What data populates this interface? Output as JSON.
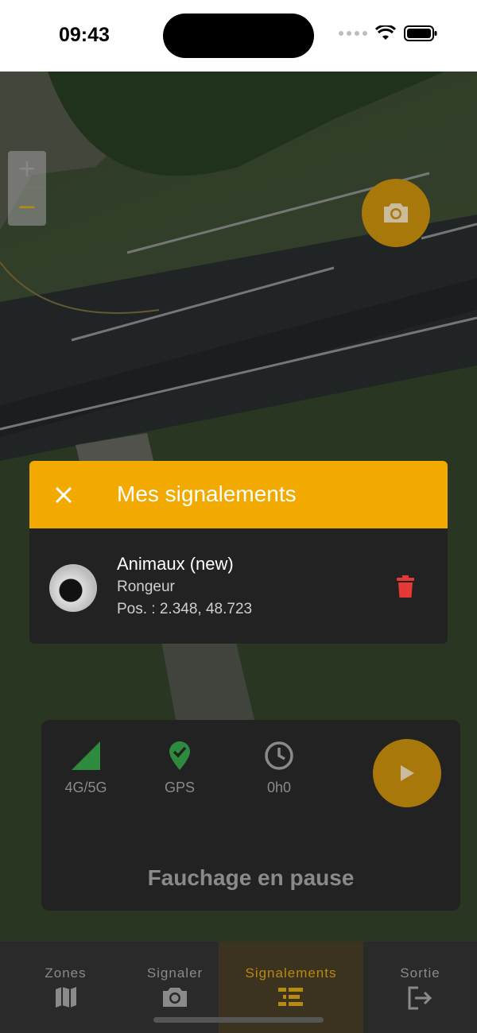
{
  "status_bar": {
    "time": "09:43"
  },
  "map": {
    "zoom_in_label": "+",
    "zoom_out_label": "−",
    "camera_icon": "camera-icon"
  },
  "reports_panel": {
    "title": "Mes signalements",
    "close_icon": "close-icon",
    "items": [
      {
        "title": "Animaux (new)",
        "subtitle": "Rongeur",
        "position": "Pos. : 2.348, 48.723",
        "delete_icon": "trash-icon"
      }
    ]
  },
  "mowing_panel": {
    "indicators": [
      {
        "label": "4G/5G",
        "icon": "signal-icon",
        "color": "#2e8b3e"
      },
      {
        "label": "GPS",
        "icon": "gps-check-icon",
        "color": "#2e8b3e"
      },
      {
        "label": "0h0",
        "icon": "clock-icon",
        "color": "#8a8a8a"
      }
    ],
    "play_icon": "play-icon",
    "status": "Fauchage en pause"
  },
  "nav": {
    "items": [
      {
        "label": "Zones",
        "icon": "map-icon",
        "active": false
      },
      {
        "label": "Signaler",
        "icon": "camera-icon",
        "active": false
      },
      {
        "label": "Signalements",
        "icon": "list-icon",
        "active": true
      },
      {
        "label": "Sortie",
        "icon": "exit-icon",
        "active": false
      }
    ]
  },
  "colors": {
    "accent": "#f2a900",
    "accent_dim": "#a8790a",
    "panel": "#222222",
    "danger": "#e53935"
  }
}
